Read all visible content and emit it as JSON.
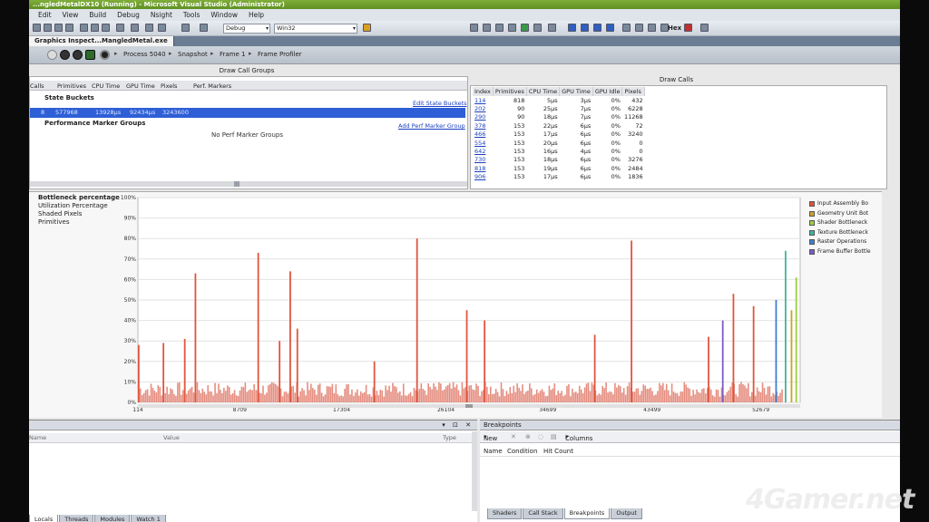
{
  "window": {
    "title": "...ngledMetalDX10 (Running) - Microsoft Visual Studio (Administrator)"
  },
  "menu": [
    "Edit",
    "View",
    "Build",
    "Debug",
    "Nsight",
    "Tools",
    "Window",
    "Help"
  ],
  "toolbar": {
    "config": "Debug",
    "platform": "Win32",
    "hex_label": "Hex"
  },
  "doc_tab": "Graphics Inspect...MangledMetal.exe",
  "breadcrumb": [
    "Process 5040",
    "Snapshot",
    "Frame 1",
    "Frame Profiler"
  ],
  "draw_call_groups": {
    "title": "Draw Call Groups",
    "columns": [
      "Calls",
      "Primitives",
      "CPU Time",
      "GPU Time",
      "Pixels",
      "Perf. Markers"
    ],
    "state_buckets_label": "State Buckets",
    "edit_state_buckets": "Edit State Buckets",
    "selected_row": {
      "calls": "8",
      "primitives": "577968",
      "cpu_time": "13928μs",
      "gpu_time": "92434μs",
      "pixels": "3243600"
    },
    "perf_marker_groups_label": "Performance Marker Groups",
    "add_perf_marker_group": "Add Perf Marker Group",
    "empty_message": "No Perf Marker Groups"
  },
  "draw_calls": {
    "title": "Draw Calls",
    "columns": [
      "Index",
      "Primitives",
      "CPU Time",
      "GPU Time",
      "GPU Idle",
      "Pixels"
    ],
    "rows": [
      [
        "114",
        "818",
        "5μs",
        "3μs",
        "0%",
        "432"
      ],
      [
        "202",
        "90",
        "25μs",
        "7μs",
        "0%",
        "6228"
      ],
      [
        "290",
        "90",
        "18μs",
        "7μs",
        "0%",
        "11268"
      ],
      [
        "378",
        "153",
        "22μs",
        "6μs",
        "0%",
        "72"
      ],
      [
        "466",
        "153",
        "17μs",
        "6μs",
        "0%",
        "3240"
      ],
      [
        "554",
        "153",
        "20μs",
        "6μs",
        "0%",
        "0"
      ],
      [
        "642",
        "153",
        "16μs",
        "4μs",
        "0%",
        "0"
      ],
      [
        "730",
        "153",
        "18μs",
        "6μs",
        "0%",
        "3276"
      ],
      [
        "818",
        "153",
        "19μs",
        "6μs",
        "0%",
        "2484"
      ],
      [
        "906",
        "153",
        "17μs",
        "6μs",
        "0%",
        "1836"
      ]
    ]
  },
  "graph": {
    "series_list": [
      "Bottleneck percentage",
      "Utilization Percentage",
      "Shaded Pixels",
      "Primitives"
    ],
    "legend": [
      {
        "name": "Input Assembly Bo",
        "color": "#e0553f"
      },
      {
        "name": "Geometry Unit Bot",
        "color": "#c9a32a"
      },
      {
        "name": "Shader Bottleneck",
        "color": "#9ccf3f"
      },
      {
        "name": "Texture Bottleneck",
        "color": "#3fb59a"
      },
      {
        "name": "Raster Operations",
        "color": "#3f7fd0"
      },
      {
        "name": "Frame Buffer Bottle",
        "color": "#7a5cc8"
      }
    ]
  },
  "chart_data": {
    "type": "bar",
    "title": "",
    "ylabel": "",
    "xlabel": "",
    "ylim": [
      0,
      100
    ],
    "y_ticks": [
      "0%",
      "10%",
      "20%",
      "30%",
      "40%",
      "50%",
      "60%",
      "70%",
      "80%",
      "90%",
      "100%"
    ],
    "x_ticks": [
      114,
      8709,
      17304,
      26104,
      34699,
      43499,
      52679
    ],
    "x_range": [
      114,
      56000
    ],
    "spikes": [
      {
        "series": "Input Assembly Bo",
        "x": 114,
        "value": 28
      },
      {
        "series": "Input Assembly Bo",
        "x": 2200,
        "value": 29
      },
      {
        "series": "Input Assembly Bo",
        "x": 4000,
        "value": 31
      },
      {
        "series": "Input Assembly Bo",
        "x": 4900,
        "value": 63
      },
      {
        "series": "Input Assembly Bo",
        "x": 10200,
        "value": 73
      },
      {
        "series": "Input Assembly Bo",
        "x": 12000,
        "value": 30
      },
      {
        "series": "Input Assembly Bo",
        "x": 12900,
        "value": 64
      },
      {
        "series": "Input Assembly Bo",
        "x": 13500,
        "value": 36
      },
      {
        "series": "Input Assembly Bo",
        "x": 20000,
        "value": 20
      },
      {
        "series": "Input Assembly Bo",
        "x": 23600,
        "value": 80
      },
      {
        "series": "Input Assembly Bo",
        "x": 27800,
        "value": 45
      },
      {
        "series": "Input Assembly Bo",
        "x": 29300,
        "value": 40
      },
      {
        "series": "Input Assembly Bo",
        "x": 38600,
        "value": 33
      },
      {
        "series": "Input Assembly Bo",
        "x": 41700,
        "value": 79
      },
      {
        "series": "Input Assembly Bo",
        "x": 48200,
        "value": 32
      },
      {
        "series": "Input Assembly Bo",
        "x": 50300,
        "value": 53
      },
      {
        "series": "Input Assembly Bo",
        "x": 52000,
        "value": 47
      },
      {
        "series": "Frame Buffer Bottle",
        "x": 49400,
        "value": 40
      },
      {
        "series": "Texture Bottleneck",
        "x": 54700,
        "value": 74
      },
      {
        "series": "Shader Bottleneck",
        "x": 55600,
        "value": 61
      },
      {
        "series": "Geometry Unit Bot",
        "x": 55200,
        "value": 45
      },
      {
        "series": "Raster Operations",
        "x": 53900,
        "value": 50
      }
    ],
    "baseline_value": 8
  },
  "bottom_left": {
    "columns": [
      "Name",
      "Value",
      "Type"
    ],
    "tabs": [
      "Locals",
      "Threads",
      "Modules",
      "Watch 1"
    ]
  },
  "breakpoints": {
    "title": "Breakpoints",
    "new_label": "New",
    "columns_label": "Columns",
    "headers": [
      "Name",
      "Condition",
      "Hit Count"
    ],
    "tabs": [
      "Shaders",
      "Call Stack",
      "Breakpoints",
      "Output"
    ]
  },
  "watermark": "4Gamer.net"
}
